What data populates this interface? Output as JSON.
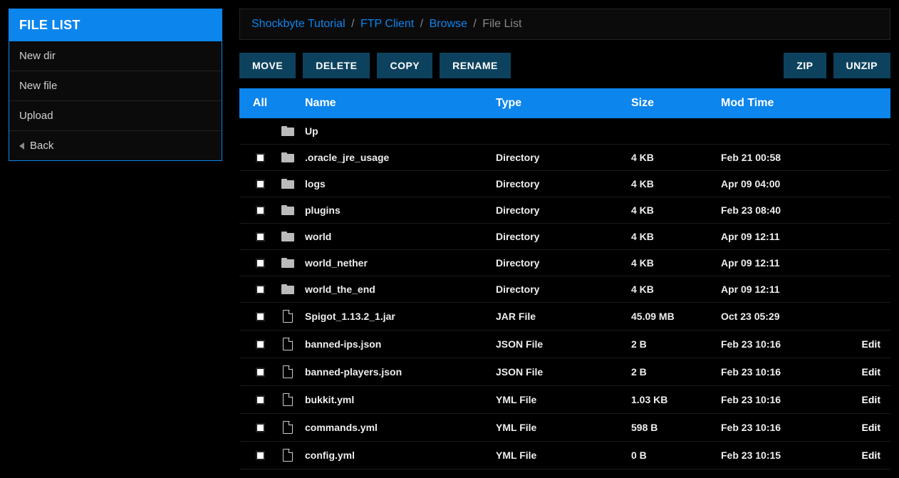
{
  "sidebar": {
    "title": "FILE LIST",
    "items": [
      {
        "label": "New dir",
        "name": "sidebar-item-new-dir"
      },
      {
        "label": "New file",
        "name": "sidebar-item-new-file"
      },
      {
        "label": "Upload",
        "name": "sidebar-item-upload"
      },
      {
        "label": "Back",
        "name": "sidebar-item-back",
        "icon": "arrow-left"
      }
    ]
  },
  "breadcrumb": {
    "items": [
      "Shockbyte Tutorial",
      "FTP Client",
      "Browse"
    ],
    "current": "File List"
  },
  "toolbar": {
    "left": [
      {
        "label": "MOVE",
        "name": "move-button"
      },
      {
        "label": "DELETE",
        "name": "delete-button"
      },
      {
        "label": "COPY",
        "name": "copy-button"
      },
      {
        "label": "RENAME",
        "name": "rename-button"
      }
    ],
    "right": [
      {
        "label": "ZIP",
        "name": "zip-button"
      },
      {
        "label": "UNZIP",
        "name": "unzip-button"
      }
    ]
  },
  "table": {
    "headers": {
      "all": "All",
      "name": "Name",
      "type": "Type",
      "size": "Size",
      "time": "Mod Time"
    },
    "up": {
      "label": "Up"
    },
    "rows": [
      {
        "icon": "folder",
        "name": ".oracle_jre_usage",
        "type": "Directory",
        "size": "4 KB",
        "time": "Feb 21 00:58",
        "edit": ""
      },
      {
        "icon": "folder",
        "name": "logs",
        "type": "Directory",
        "size": "4 KB",
        "time": "Apr 09 04:00",
        "edit": ""
      },
      {
        "icon": "folder",
        "name": "plugins",
        "type": "Directory",
        "size": "4 KB",
        "time": "Feb 23 08:40",
        "edit": ""
      },
      {
        "icon": "folder",
        "name": "world",
        "type": "Directory",
        "size": "4 KB",
        "time": "Apr 09 12:11",
        "edit": ""
      },
      {
        "icon": "folder",
        "name": "world_nether",
        "type": "Directory",
        "size": "4 KB",
        "time": "Apr 09 12:11",
        "edit": ""
      },
      {
        "icon": "folder",
        "name": "world_the_end",
        "type": "Directory",
        "size": "4 KB",
        "time": "Apr 09 12:11",
        "edit": ""
      },
      {
        "icon": "file",
        "name": "Spigot_1.13.2_1.jar",
        "type": "JAR File",
        "size": "45.09 MB",
        "time": "Oct 23 05:29",
        "edit": ""
      },
      {
        "icon": "file",
        "name": "banned-ips.json",
        "type": "JSON File",
        "size": "2 B",
        "time": "Feb 23 10:16",
        "edit": "Edit"
      },
      {
        "icon": "file",
        "name": "banned-players.json",
        "type": "JSON File",
        "size": "2 B",
        "time": "Feb 23 10:16",
        "edit": "Edit"
      },
      {
        "icon": "file",
        "name": "bukkit.yml",
        "type": "YML File",
        "size": "1.03 KB",
        "time": "Feb 23 10:16",
        "edit": "Edit"
      },
      {
        "icon": "file",
        "name": "commands.yml",
        "type": "YML File",
        "size": "598 B",
        "time": "Feb 23 10:16",
        "edit": "Edit"
      },
      {
        "icon": "file",
        "name": "config.yml",
        "type": "YML File",
        "size": "0 B",
        "time": "Feb 23 10:15",
        "edit": "Edit"
      }
    ]
  }
}
